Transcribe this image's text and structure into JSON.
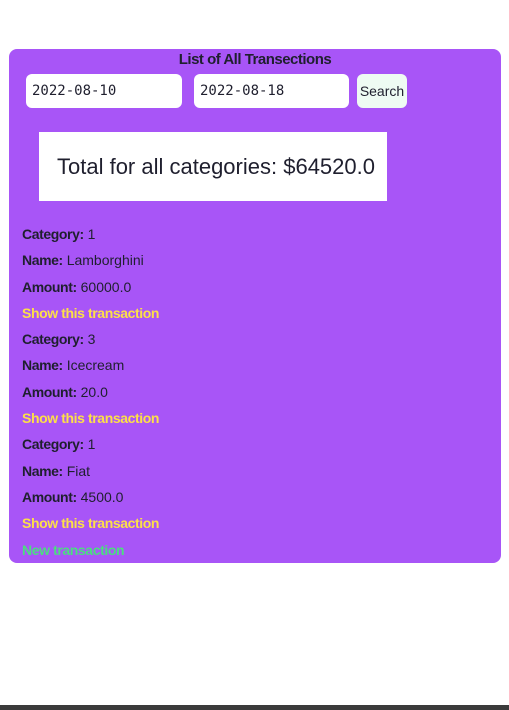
{
  "page": {
    "title": "List of All Transections",
    "filter": {
      "date_from": "2022-08-10",
      "date_to": "2022-08-18",
      "search_label": "Search"
    },
    "total": {
      "text": "Total for all categories: $64520.0"
    },
    "labels": {
      "category": "Category:",
      "name": "Name:",
      "amount": "Amount:",
      "show_link": "Show this transaction"
    },
    "transactions": [
      {
        "category": "1",
        "name": "Lamborghini",
        "amount": "60000.0"
      },
      {
        "category": "3",
        "name": "Icecream",
        "amount": "20.0"
      },
      {
        "category": "1",
        "name": "Fiat",
        "amount": "4500.0"
      }
    ],
    "new_transaction_label": "New transaction"
  },
  "colors": {
    "panel": "#a855f7",
    "link": "#fde047",
    "new_link": "#4ade80",
    "text": "#1f1f2e"
  }
}
